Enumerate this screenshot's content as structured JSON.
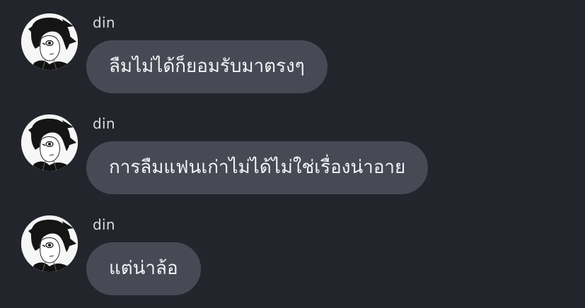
{
  "messages": [
    {
      "sender": "din",
      "text": "ลืมไม่ได้ก็ยอมรับมาตรงๆ",
      "avatar_icon": "avatar-icon"
    },
    {
      "sender": "din",
      "text": "การลืมแฟนเก่าไม่ได้ไม่ใช่เรื่องน่าอาย",
      "avatar_icon": "avatar-icon"
    },
    {
      "sender": "din",
      "text": "แต่น่าล้อ",
      "avatar_icon": "avatar-icon"
    }
  ],
  "colors": {
    "background": "#23252d",
    "bubble": "#474a55",
    "text": "#f2f3f5",
    "sender": "#d9dbe0"
  }
}
